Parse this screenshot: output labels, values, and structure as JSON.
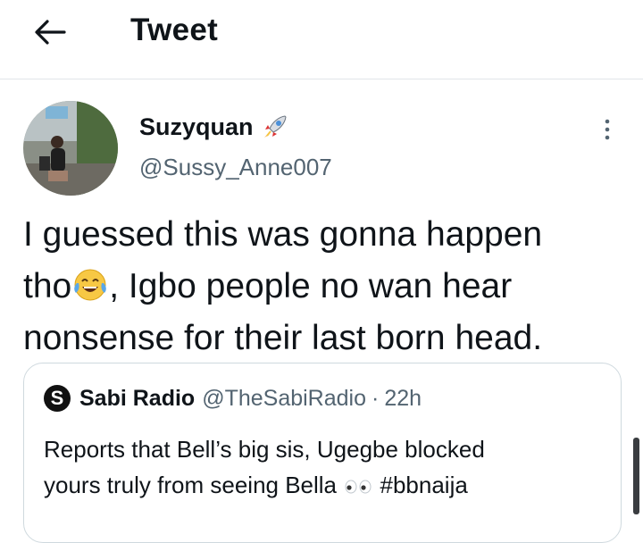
{
  "header": {
    "title": "Tweet",
    "back_icon": "arrow-left-icon"
  },
  "author": {
    "name": "Suzyquan",
    "handle": "@Sussy_Anne007",
    "badge_icon": "rocket-emoji-icon"
  },
  "tweet": {
    "line1": "I guessed this was gonna happen",
    "line2_a": "tho",
    "line2_emoji": "face-with-tears-of-joy-emoji",
    "line2_b": ", Igbo people no wan hear",
    "line3": "nonsense for their last born head."
  },
  "quoted_tweet": {
    "logo_letter": "S",
    "name": "Sabi Radio",
    "handle": "@TheSabiRadio",
    "separator": "·",
    "time": "22h",
    "text_line1": "Reports that Bell’s big sis, Ugegbe blocked",
    "text_line2_a": "yours truly from seeing Bella",
    "text_emoji": "eyes-emoji",
    "text_line2_b": "#bbnaija"
  },
  "colors": {
    "text": "#0f1419",
    "secondary": "#536471",
    "border": "#cfd9de"
  }
}
